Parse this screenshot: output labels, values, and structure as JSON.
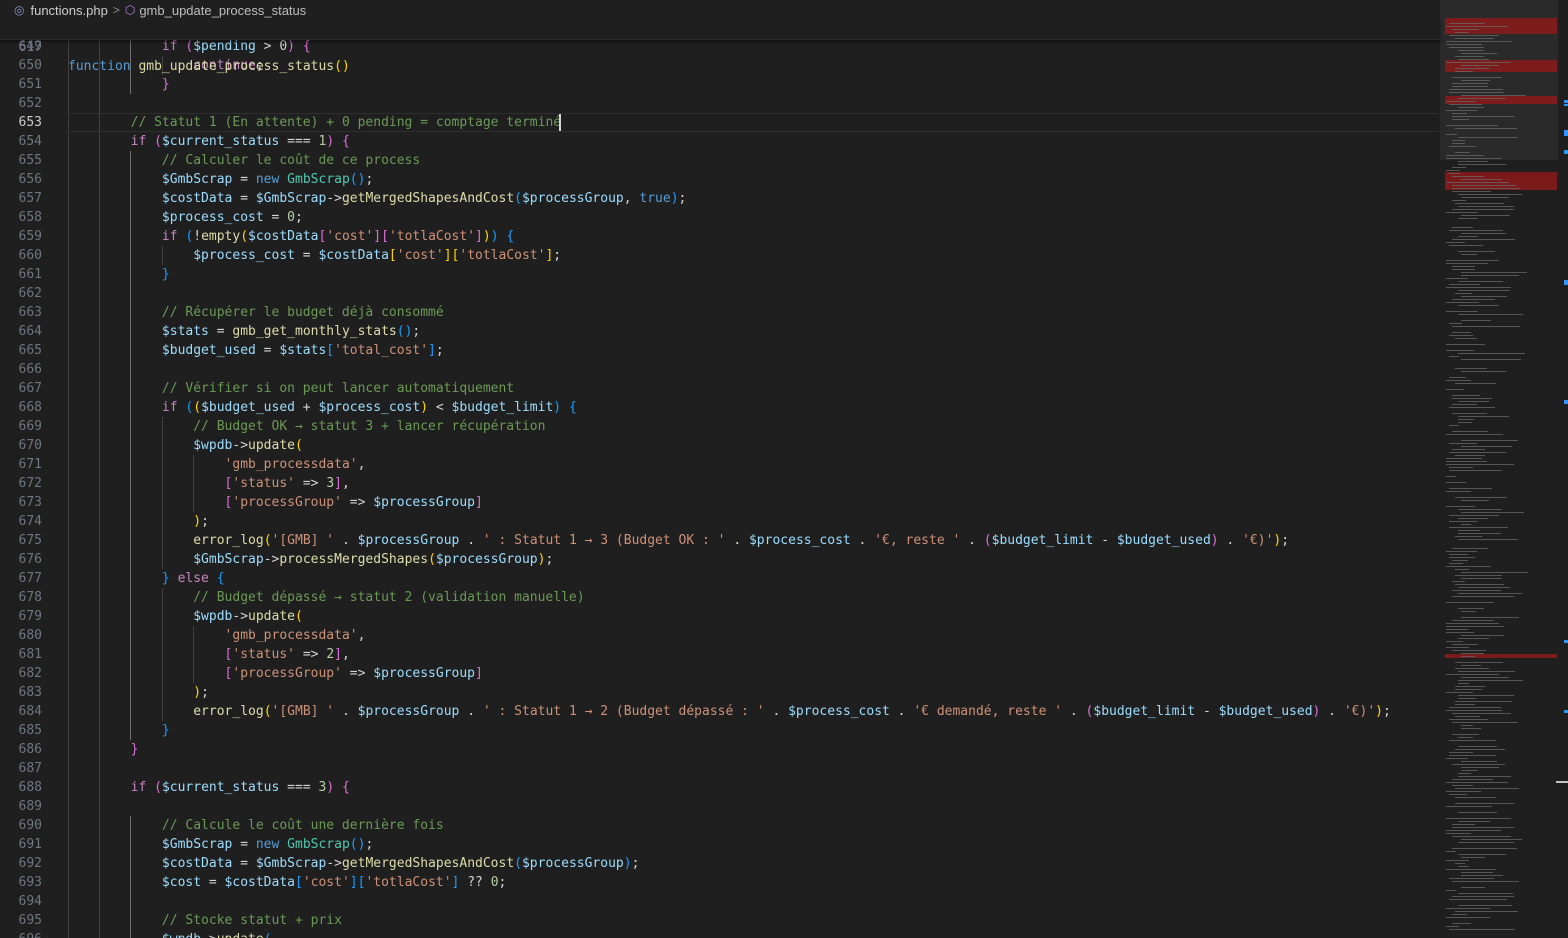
{
  "breadcrumb": {
    "file_icon": "php-file-icon",
    "file": "functions.php",
    "separator": ">",
    "symbol_icon": "method-cube-icon",
    "symbol": "gmb_update_process_status"
  },
  "active_line": "653",
  "sticky": {
    "ln": "617",
    "tokens": [
      [
        "k",
        "function"
      ],
      [
        "p",
        " "
      ],
      [
        "fn",
        "gmb_update_process_status"
      ],
      [
        "b1",
        "()"
      ]
    ]
  },
  "lines": [
    {
      "ln": "649",
      "ind": 3,
      "tokens": [
        [
          "ctl",
          "if"
        ],
        [
          "p",
          " "
        ],
        [
          "b2",
          "("
        ],
        [
          "v",
          "$pending"
        ],
        [
          "p",
          " > 0"
        ],
        [
          "b2",
          ")"
        ],
        [
          "p",
          " "
        ],
        [
          "b2",
          "{"
        ]
      ]
    },
    {
      "ln": "650",
      "ind": 4,
      "tokens": [
        [
          "ctl",
          "continue"
        ],
        [
          "p",
          ";"
        ]
      ]
    },
    {
      "ln": "651",
      "ind": 3,
      "tokens": [
        [
          "b2",
          "}"
        ]
      ]
    },
    {
      "ln": "652",
      "ind": 0,
      "tokens": []
    },
    {
      "ln": "653",
      "ind": 2,
      "tokens": [
        [
          "c",
          "// Statut 1 (En attente) + 0 pending = comptage terminé"
        ]
      ]
    },
    {
      "ln": "654",
      "ind": 2,
      "tokens": [
        [
          "ctl",
          "if"
        ],
        [
          "p",
          " "
        ],
        [
          "b2",
          "("
        ],
        [
          "v",
          "$current_status"
        ],
        [
          "p",
          " === "
        ],
        [
          "n",
          "1"
        ],
        [
          "b2",
          ")"
        ],
        [
          "p",
          " "
        ],
        [
          "b2",
          "{"
        ]
      ]
    },
    {
      "ln": "655",
      "ind": 3,
      "tokens": [
        [
          "c",
          "// Calculer le coût de ce process"
        ]
      ]
    },
    {
      "ln": "656",
      "ind": 3,
      "tokens": [
        [
          "v",
          "$GmbScrap"
        ],
        [
          "p",
          " = "
        ],
        [
          "k",
          "new"
        ],
        [
          "p",
          " "
        ],
        [
          "ty",
          "GmbScrap"
        ],
        [
          "b3",
          "()"
        ],
        [
          "p",
          ";"
        ]
      ]
    },
    {
      "ln": "657",
      "ind": 3,
      "tokens": [
        [
          "v",
          "$costData"
        ],
        [
          "p",
          " = "
        ],
        [
          "v",
          "$GmbScrap"
        ],
        [
          "p",
          "->"
        ],
        [
          "fn",
          "getMergedShapesAndCost"
        ],
        [
          "b3",
          "("
        ],
        [
          "v",
          "$processGroup"
        ],
        [
          "p",
          ", "
        ],
        [
          "k",
          "true"
        ],
        [
          "b3",
          ")"
        ],
        [
          "p",
          ";"
        ]
      ]
    },
    {
      "ln": "658",
      "ind": 3,
      "tokens": [
        [
          "v",
          "$process_cost"
        ],
        [
          "p",
          " = "
        ],
        [
          "n",
          "0"
        ],
        [
          "p",
          ";"
        ]
      ]
    },
    {
      "ln": "659",
      "ind": 3,
      "tokens": [
        [
          "ctl",
          "if"
        ],
        [
          "p",
          " "
        ],
        [
          "b3",
          "("
        ],
        [
          "p",
          "!"
        ],
        [
          "fn",
          "empty"
        ],
        [
          "b1",
          "("
        ],
        [
          "v",
          "$costData"
        ],
        [
          "b2",
          "["
        ],
        [
          "s",
          "'cost'"
        ],
        [
          "b2",
          "]["
        ],
        [
          "s",
          "'totlaCost'"
        ],
        [
          "b2",
          "]"
        ],
        [
          "b1",
          ")"
        ],
        [
          "b3",
          ")"
        ],
        [
          "p",
          " "
        ],
        [
          "b3",
          "{"
        ]
      ]
    },
    {
      "ln": "660",
      "ind": 4,
      "tokens": [
        [
          "v",
          "$process_cost"
        ],
        [
          "p",
          " = "
        ],
        [
          "v",
          "$costData"
        ],
        [
          "b1",
          "["
        ],
        [
          "s",
          "'cost'"
        ],
        [
          "b1",
          "]["
        ],
        [
          "s",
          "'totlaCost'"
        ],
        [
          "b1",
          "]"
        ],
        [
          "p",
          ";"
        ]
      ]
    },
    {
      "ln": "661",
      "ind": 3,
      "tokens": [
        [
          "b3",
          "}"
        ]
      ]
    },
    {
      "ln": "662",
      "ind": 0,
      "tokens": []
    },
    {
      "ln": "663",
      "ind": 3,
      "tokens": [
        [
          "c",
          "// Récupérer le budget déjà consommé"
        ]
      ]
    },
    {
      "ln": "664",
      "ind": 3,
      "tokens": [
        [
          "v",
          "$stats"
        ],
        [
          "p",
          " = "
        ],
        [
          "fn",
          "gmb_get_monthly_stats"
        ],
        [
          "b3",
          "()"
        ],
        [
          "p",
          ";"
        ]
      ]
    },
    {
      "ln": "665",
      "ind": 3,
      "tokens": [
        [
          "v",
          "$budget_used"
        ],
        [
          "p",
          " = "
        ],
        [
          "v",
          "$stats"
        ],
        [
          "b3",
          "["
        ],
        [
          "s",
          "'total_cost'"
        ],
        [
          "b3",
          "]"
        ],
        [
          "p",
          ";"
        ]
      ]
    },
    {
      "ln": "666",
      "ind": 0,
      "tokens": []
    },
    {
      "ln": "667",
      "ind": 3,
      "tokens": [
        [
          "c",
          "// Vérifier si on peut lancer automatiquement"
        ]
      ]
    },
    {
      "ln": "668",
      "ind": 3,
      "tokens": [
        [
          "ctl",
          "if"
        ],
        [
          "p",
          " "
        ],
        [
          "b3",
          "("
        ],
        [
          "b1",
          "("
        ],
        [
          "v",
          "$budget_used"
        ],
        [
          "p",
          " + "
        ],
        [
          "v",
          "$process_cost"
        ],
        [
          "b1",
          ")"
        ],
        [
          "p",
          " < "
        ],
        [
          "v",
          "$budget_limit"
        ],
        [
          "b3",
          ")"
        ],
        [
          "p",
          " "
        ],
        [
          "b3",
          "{"
        ]
      ]
    },
    {
      "ln": "669",
      "ind": 4,
      "tokens": [
        [
          "c",
          "// Budget OK → statut 3 + lancer récupération"
        ]
      ]
    },
    {
      "ln": "670",
      "ind": 4,
      "tokens": [
        [
          "v",
          "$wpdb"
        ],
        [
          "p",
          "->"
        ],
        [
          "fn",
          "update"
        ],
        [
          "b1",
          "("
        ]
      ]
    },
    {
      "ln": "671",
      "ind": 5,
      "tokens": [
        [
          "s",
          "'gmb_processdata'"
        ],
        [
          "p",
          ","
        ]
      ]
    },
    {
      "ln": "672",
      "ind": 5,
      "tokens": [
        [
          "b2",
          "["
        ],
        [
          "s",
          "'status'"
        ],
        [
          "p",
          " => "
        ],
        [
          "n",
          "3"
        ],
        [
          "b2",
          "]"
        ],
        [
          "p",
          ","
        ]
      ]
    },
    {
      "ln": "673",
      "ind": 5,
      "tokens": [
        [
          "b2",
          "["
        ],
        [
          "s",
          "'processGroup'"
        ],
        [
          "p",
          " => "
        ],
        [
          "v",
          "$processGroup"
        ],
        [
          "b2",
          "]"
        ]
      ]
    },
    {
      "ln": "674",
      "ind": 4,
      "tokens": [
        [
          "b1",
          ")"
        ],
        [
          "p",
          ";"
        ]
      ]
    },
    {
      "ln": "675",
      "ind": 4,
      "tokens": [
        [
          "fn",
          "error_log"
        ],
        [
          "b1",
          "("
        ],
        [
          "s",
          "'[GMB] '"
        ],
        [
          "p",
          " . "
        ],
        [
          "v",
          "$processGroup"
        ],
        [
          "p",
          " . "
        ],
        [
          "s",
          "' : Statut 1 → 3 (Budget OK : '"
        ],
        [
          "p",
          " . "
        ],
        [
          "v",
          "$process_cost"
        ],
        [
          "p",
          " . "
        ],
        [
          "s",
          "'€, reste '"
        ],
        [
          "p",
          " . "
        ],
        [
          "b2",
          "("
        ],
        [
          "v",
          "$budget_limit"
        ],
        [
          "p",
          " - "
        ],
        [
          "v",
          "$budget_used"
        ],
        [
          "b2",
          ")"
        ],
        [
          "p",
          " . "
        ],
        [
          "s",
          "'€)'"
        ],
        [
          "b1",
          ")"
        ],
        [
          "p",
          ";"
        ]
      ]
    },
    {
      "ln": "676",
      "ind": 4,
      "tokens": [
        [
          "v",
          "$GmbScrap"
        ],
        [
          "p",
          "->"
        ],
        [
          "fn",
          "processMergedShapes"
        ],
        [
          "b1",
          "("
        ],
        [
          "v",
          "$processGroup"
        ],
        [
          "b1",
          ")"
        ],
        [
          "p",
          ";"
        ]
      ]
    },
    {
      "ln": "677",
      "ind": 3,
      "tokens": [
        [
          "b3",
          "}"
        ],
        [
          "p",
          " "
        ],
        [
          "ctl",
          "else"
        ],
        [
          "p",
          " "
        ],
        [
          "b3",
          "{"
        ]
      ]
    },
    {
      "ln": "678",
      "ind": 4,
      "tokens": [
        [
          "c",
          "// Budget dépassé → statut 2 (validation manuelle)"
        ]
      ]
    },
    {
      "ln": "679",
      "ind": 4,
      "tokens": [
        [
          "v",
          "$wpdb"
        ],
        [
          "p",
          "->"
        ],
        [
          "fn",
          "update"
        ],
        [
          "b1",
          "("
        ]
      ]
    },
    {
      "ln": "680",
      "ind": 5,
      "tokens": [
        [
          "s",
          "'gmb_processdata'"
        ],
        [
          "p",
          ","
        ]
      ]
    },
    {
      "ln": "681",
      "ind": 5,
      "tokens": [
        [
          "b2",
          "["
        ],
        [
          "s",
          "'status'"
        ],
        [
          "p",
          " => "
        ],
        [
          "n",
          "2"
        ],
        [
          "b2",
          "]"
        ],
        [
          "p",
          ","
        ]
      ]
    },
    {
      "ln": "682",
      "ind": 5,
      "tokens": [
        [
          "b2",
          "["
        ],
        [
          "s",
          "'processGroup'"
        ],
        [
          "p",
          " => "
        ],
        [
          "v",
          "$processGroup"
        ],
        [
          "b2",
          "]"
        ]
      ]
    },
    {
      "ln": "683",
      "ind": 4,
      "tokens": [
        [
          "b1",
          ")"
        ],
        [
          "p",
          ";"
        ]
      ]
    },
    {
      "ln": "684",
      "ind": 4,
      "tokens": [
        [
          "fn",
          "error_log"
        ],
        [
          "b1",
          "("
        ],
        [
          "s",
          "'[GMB] '"
        ],
        [
          "p",
          " . "
        ],
        [
          "v",
          "$processGroup"
        ],
        [
          "p",
          " . "
        ],
        [
          "s",
          "' : Statut 1 → 2 (Budget dépassé : '"
        ],
        [
          "p",
          " . "
        ],
        [
          "v",
          "$process_cost"
        ],
        [
          "p",
          " . "
        ],
        [
          "s",
          "'€ demandé, reste '"
        ],
        [
          "p",
          " . "
        ],
        [
          "b2",
          "("
        ],
        [
          "v",
          "$budget_limit"
        ],
        [
          "p",
          " - "
        ],
        [
          "v",
          "$budget_used"
        ],
        [
          "b2",
          ")"
        ],
        [
          "p",
          " . "
        ],
        [
          "s",
          "'€)'"
        ],
        [
          "b1",
          ")"
        ],
        [
          "p",
          ";"
        ]
      ]
    },
    {
      "ln": "685",
      "ind": 3,
      "tokens": [
        [
          "b3",
          "}"
        ]
      ]
    },
    {
      "ln": "686",
      "ind": 2,
      "tokens": [
        [
          "b2",
          "}"
        ]
      ]
    },
    {
      "ln": "687",
      "ind": 0,
      "tokens": []
    },
    {
      "ln": "688",
      "ind": 2,
      "tokens": [
        [
          "ctl",
          "if"
        ],
        [
          "p",
          " "
        ],
        [
          "b2",
          "("
        ],
        [
          "v",
          "$current_status"
        ],
        [
          "p",
          " === "
        ],
        [
          "n",
          "3"
        ],
        [
          "b2",
          ")"
        ],
        [
          "p",
          " "
        ],
        [
          "b2",
          "{"
        ]
      ]
    },
    {
      "ln": "689",
      "ind": 0,
      "tokens": []
    },
    {
      "ln": "690",
      "ind": 3,
      "tokens": [
        [
          "c",
          "// Calcule le coût une dernière fois"
        ]
      ]
    },
    {
      "ln": "691",
      "ind": 3,
      "tokens": [
        [
          "v",
          "$GmbScrap"
        ],
        [
          "p",
          " = "
        ],
        [
          "k",
          "new"
        ],
        [
          "p",
          " "
        ],
        [
          "ty",
          "GmbScrap"
        ],
        [
          "b3",
          "()"
        ],
        [
          "p",
          ";"
        ]
      ]
    },
    {
      "ln": "692",
      "ind": 3,
      "tokens": [
        [
          "v",
          "$costData"
        ],
        [
          "p",
          " = "
        ],
        [
          "v",
          "$GmbScrap"
        ],
        [
          "p",
          "->"
        ],
        [
          "fn",
          "getMergedShapesAndCost"
        ],
        [
          "b3",
          "("
        ],
        [
          "v",
          "$processGroup"
        ],
        [
          "b3",
          ")"
        ],
        [
          "p",
          ";"
        ]
      ]
    },
    {
      "ln": "693",
      "ind": 3,
      "tokens": [
        [
          "v",
          "$cost"
        ],
        [
          "p",
          " = "
        ],
        [
          "v",
          "$costData"
        ],
        [
          "b3",
          "["
        ],
        [
          "s",
          "'cost'"
        ],
        [
          "b3",
          "]["
        ],
        [
          "s",
          "'totlaCost'"
        ],
        [
          "b3",
          "]"
        ],
        [
          "p",
          " ?? "
        ],
        [
          "n",
          "0"
        ],
        [
          "p",
          ";"
        ]
      ]
    },
    {
      "ln": "694",
      "ind": 0,
      "tokens": []
    },
    {
      "ln": "695",
      "ind": 3,
      "tokens": [
        [
          "c",
          "// Stocke statut + prix"
        ]
      ]
    },
    {
      "ln": "696",
      "ind": 3,
      "tokens": [
        [
          "v",
          "$wpdb"
        ],
        [
          "p",
          "->"
        ],
        [
          "fn",
          "update"
        ],
        [
          "b3",
          "("
        ]
      ]
    }
  ]
}
